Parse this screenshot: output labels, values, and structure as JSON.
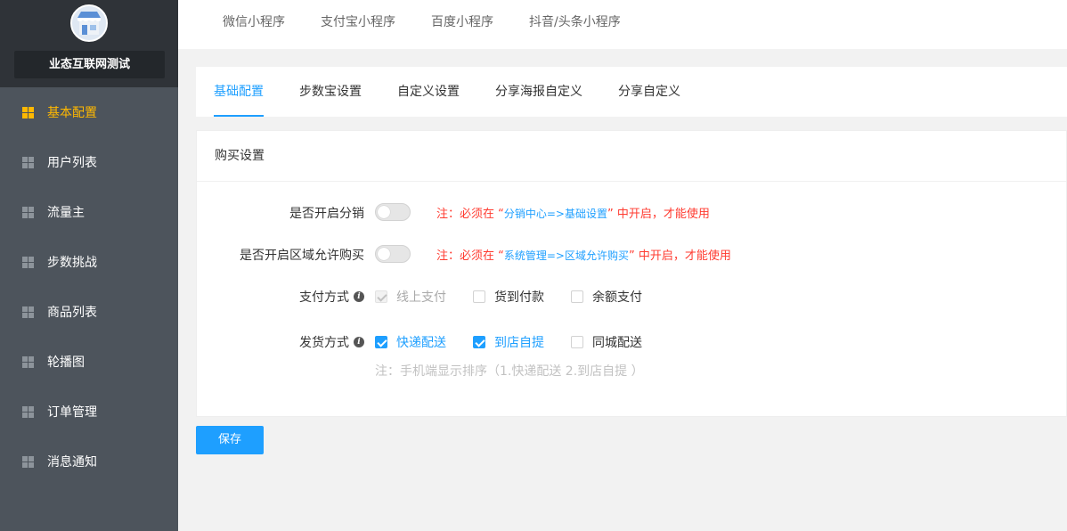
{
  "brand": {
    "name": "业态互联网测试",
    "logo_icon": "store-icon"
  },
  "sidebar": {
    "items": [
      {
        "label": "基本配置",
        "active": true
      },
      {
        "label": "用户列表"
      },
      {
        "label": "流量主"
      },
      {
        "label": "步数挑战"
      },
      {
        "label": "商品列表"
      },
      {
        "label": "轮播图"
      },
      {
        "label": "订单管理"
      },
      {
        "label": "消息通知"
      }
    ]
  },
  "top_tabs": [
    "微信小程序",
    "支付宝小程序",
    "百度小程序",
    "抖音/头条小程序"
  ],
  "sub_tabs": [
    "基础配置",
    "步数宝设置",
    "自定义设置",
    "分享海报自定义",
    "分享自定义"
  ],
  "purchase": {
    "title": "购买设置",
    "distribution": {
      "label": "是否开启分销",
      "enabled": false,
      "note_prefix": "注：必须在 “",
      "note_link": "分销中心=>基础设置",
      "note_suffix": "” 中开启，才能使用"
    },
    "region": {
      "label": "是否开启区域允许购买",
      "enabled": false,
      "note_prefix": "注：必须在 “",
      "note_link": "系统管理=>区域允许购买",
      "note_suffix": "” 中开启，才能使用"
    },
    "payment": {
      "label": "支付方式",
      "options": [
        {
          "label": "线上支付",
          "checked": true,
          "disabled": true
        },
        {
          "label": "货到付款",
          "checked": false
        },
        {
          "label": "余额支付",
          "checked": false
        }
      ]
    },
    "delivery": {
      "label": "发货方式",
      "options": [
        {
          "label": "快递配送",
          "checked": true
        },
        {
          "label": "到店自提",
          "checked": true
        },
        {
          "label": "同城配送",
          "checked": false
        }
      ],
      "hint": "注：手机端显示排序（1.快递配送 2.到店自提 ）"
    }
  },
  "save_label": "保存",
  "colors": {
    "accent": "#1e9fff",
    "active_menu": "#ffb800",
    "warning": "#ff3b30",
    "sidebar_bg": "#4d545c"
  }
}
